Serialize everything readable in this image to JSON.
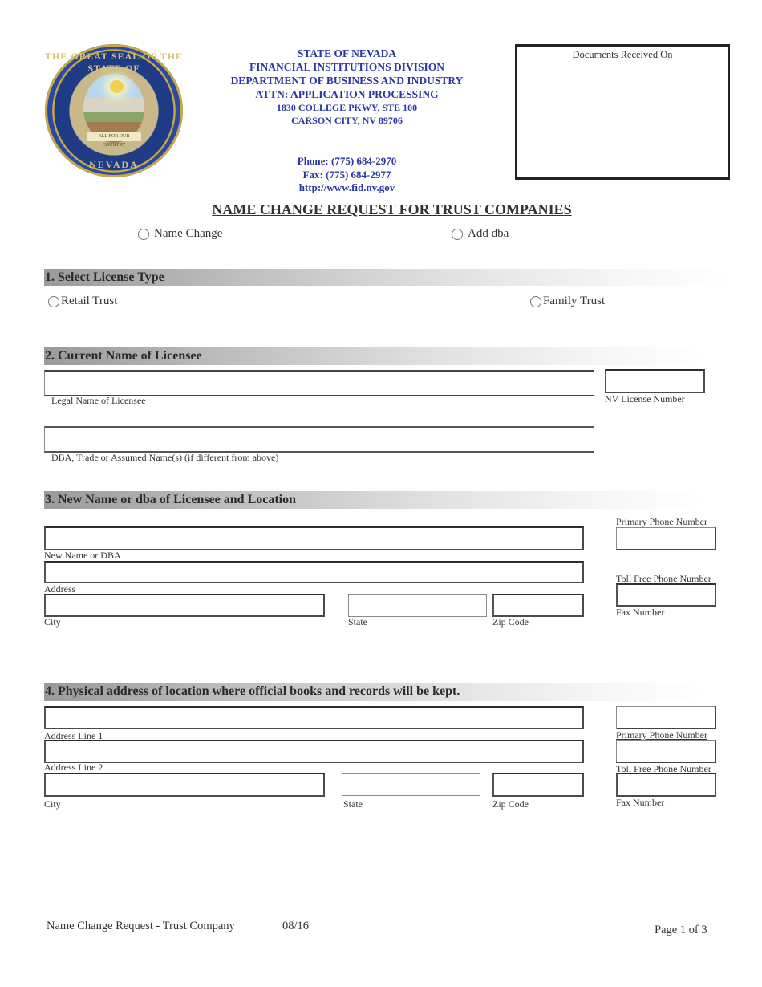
{
  "header": {
    "seal": {
      "top_text": "THE GREAT SEAL OF THE STATE OF",
      "bottom_text": "NEVADA",
      "motto": "ALL FOR OUR COUNTRY"
    },
    "agency_lines": [
      "STATE OF NEVADA",
      "FINANCIAL INSTITUTIONS DIVISION",
      "DEPARTMENT OF BUSINESS AND INDUSTRY",
      "ATTN:  APPLICATION PROCESSING"
    ],
    "address_lines": [
      "1830 COLLEGE PKWY, STE 100",
      "CARSON CITY, NV 89706"
    ],
    "phone": "Phone:  (775) 684-2970",
    "fax": "Fax:  (775) 684-2977",
    "website": "http://www.fid.nv.gov",
    "received_box_label": "Documents Received On",
    "text_color": "#2c36a3"
  },
  "form_title": "NAME CHANGE REQUEST FOR TRUST COMPANIES",
  "request_type": {
    "options": [
      "Name Change",
      "Add dba"
    ],
    "selected": null
  },
  "section1": {
    "title": "1. Select License Type",
    "options": [
      "Retail Trust",
      "Family Trust"
    ],
    "selected": null
  },
  "section2": {
    "title": "2. Current Name of Licensee",
    "fields": {
      "legal_name": {
        "label": "Legal Name of Licensee",
        "value": ""
      },
      "license_number": {
        "label": "NV License Number",
        "value": ""
      },
      "dba": {
        "label": "DBA, Trade or Assumed Name(s) (if different from above)",
        "value": ""
      }
    }
  },
  "section3": {
    "title": "3. New Name or dba of Licensee and Location",
    "fields": {
      "new_name": {
        "label": "New Name or DBA",
        "value": ""
      },
      "address": {
        "label": "Address",
        "value": ""
      },
      "city": {
        "label": "City",
        "value": ""
      },
      "state": {
        "label": "State",
        "value": ""
      },
      "zip": {
        "label": "Zip Code",
        "value": ""
      },
      "primary_phone": {
        "label": "Primary Phone Number",
        "value": ""
      },
      "toll_free_phone": {
        "label": "Toll Free Phone Number",
        "value": ""
      },
      "fax": {
        "label": "Fax Number",
        "value": ""
      }
    }
  },
  "section4": {
    "title": "4. Physical address of location where official books and records will be kept.",
    "fields": {
      "address_line1": {
        "label": "Address Line 1",
        "value": ""
      },
      "address_line2": {
        "label": "Address Line 2",
        "value": ""
      },
      "city": {
        "label": "City",
        "value": ""
      },
      "state": {
        "label": "State",
        "value": ""
      },
      "zip": {
        "label": "Zip Code",
        "value": ""
      },
      "primary_phone": {
        "label": "Primary Phone Number",
        "value": ""
      },
      "toll_free_phone": {
        "label": "Toll Free Phone Number",
        "value": ""
      },
      "fax": {
        "label": "Fax Number",
        "value": ""
      }
    }
  },
  "footer": {
    "form_name": "Name Change Request - Trust Company",
    "revision": "08/16",
    "page": "Page 1 of 3"
  }
}
